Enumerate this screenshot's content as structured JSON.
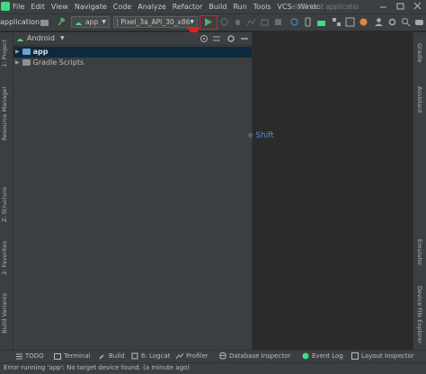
{
  "menu": {
    "items": [
      "File",
      "Edit",
      "View",
      "Navigate",
      "Code",
      "Analyze",
      "Refactor",
      "Build",
      "Run",
      "Tools",
      "VCS",
      "Windc"
    ],
    "window_title": "alphr test applicatio"
  },
  "toolbar": {
    "project_crumb": "application",
    "module_combo": "app",
    "device_combo": "Pixel_3a_API_30_x86"
  },
  "project_panel": {
    "view_selector": "Android",
    "tree": [
      {
        "label": "app",
        "selected": true
      },
      {
        "label": "Gradle Scripts",
        "selected": false
      }
    ]
  },
  "left_tabs": [
    "1: Project",
    "Resource Manager",
    "Z: Structure",
    "2: Favorites",
    "Build Variants"
  ],
  "right_tabs": [
    "Gradle",
    "Assistant",
    "Emulator",
    "Device File Explorer"
  ],
  "editor": {
    "hint_fragment": "e Shift"
  },
  "bottom_tabs": [
    "TODO",
    "Terminal",
    "Build",
    "6: Logcat",
    "Profiler",
    "Database Inspector",
    "Event Log",
    "Layout Inspector"
  ],
  "status": {
    "message": "Error running 'app': No target device found. (a minute ago)"
  },
  "colors": {
    "accent": "#3ddc84",
    "run": "#59a869",
    "highlight": "#e02020",
    "arrow": "#e02020",
    "hint": "#4f8fd9"
  }
}
